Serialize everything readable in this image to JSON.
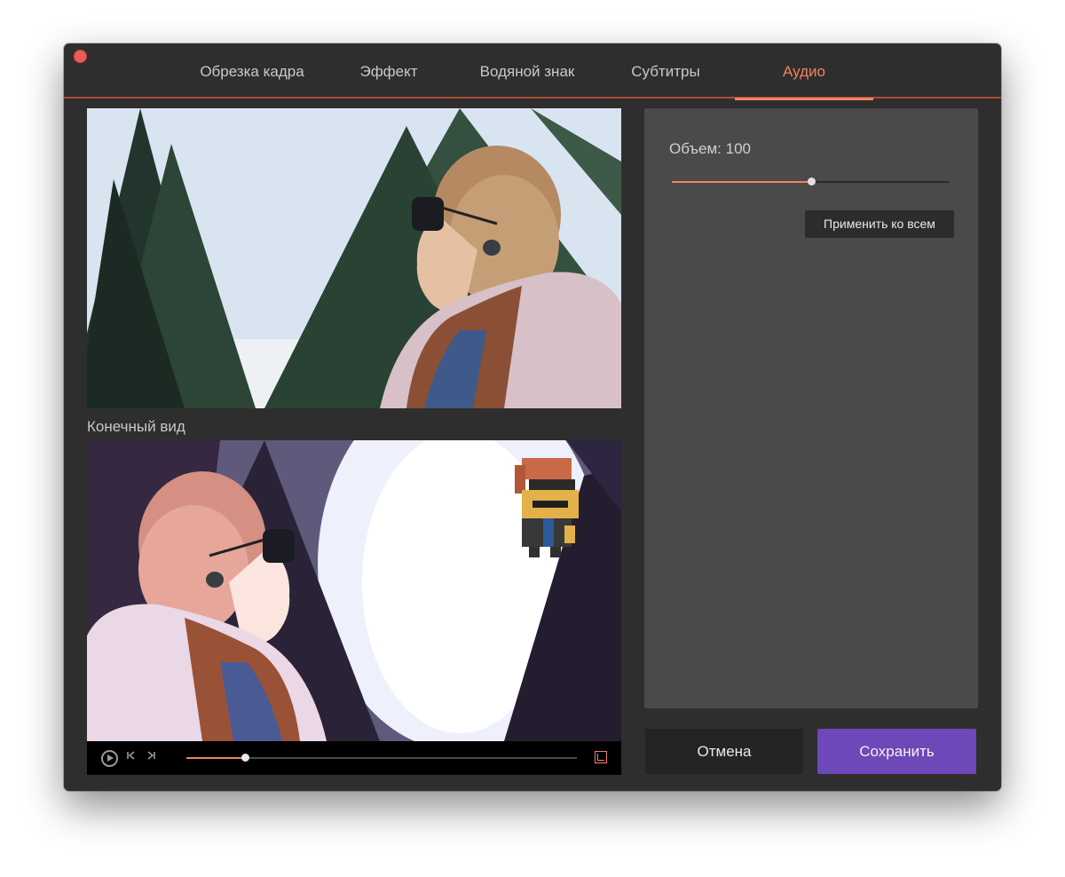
{
  "tabs": [
    {
      "label": "Обрезка кадра",
      "active": false
    },
    {
      "label": "Эффект",
      "active": false
    },
    {
      "label": "Водяной знак",
      "active": false
    },
    {
      "label": "Субтитры",
      "active": false
    },
    {
      "label": "Аудио",
      "active": true
    }
  ],
  "preview": {
    "final_label": "Конечный вид",
    "playback_progress": 0.15
  },
  "audio": {
    "volume_label": "Объем: 100",
    "volume_level": 0.5,
    "apply_all_label": "Применить ко всем"
  },
  "footer": {
    "cancel_label": "Отмена",
    "save_label": "Сохранить"
  },
  "colors": {
    "accent": "#f08262",
    "save_button": "#6c48b8",
    "window_bg": "#2f2e2e",
    "panel_bg": "#4a4a4a"
  },
  "icons": {
    "close": "close-icon",
    "play": "play-icon",
    "prev_frame": "prev-frame-icon",
    "next_frame": "next-frame-icon",
    "fullscreen": "fullscreen-icon"
  }
}
